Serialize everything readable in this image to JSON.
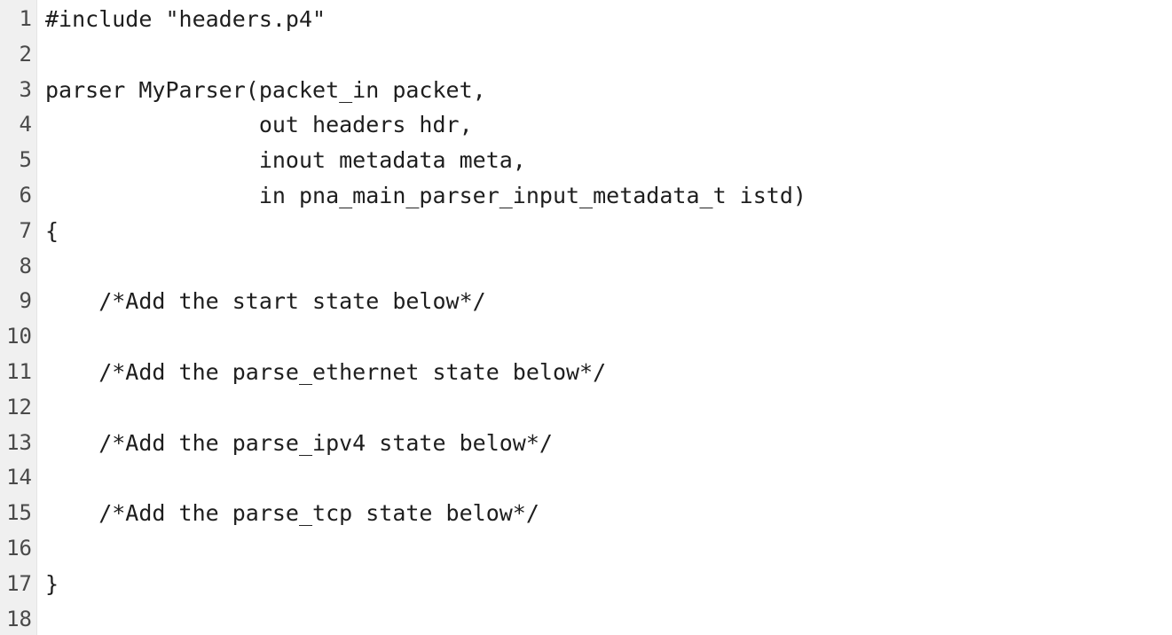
{
  "editor": {
    "lines": [
      {
        "number": "1",
        "text": "#include \"headers.p4\""
      },
      {
        "number": "2",
        "text": ""
      },
      {
        "number": "3",
        "text": "parser MyParser(packet_in packet,"
      },
      {
        "number": "4",
        "text": "                out headers hdr,"
      },
      {
        "number": "5",
        "text": "                inout metadata meta,"
      },
      {
        "number": "6",
        "text": "                in pna_main_parser_input_metadata_t istd)"
      },
      {
        "number": "7",
        "text": "{"
      },
      {
        "number": "8",
        "text": ""
      },
      {
        "number": "9",
        "text": "    /*Add the start state below*/"
      },
      {
        "number": "10",
        "text": ""
      },
      {
        "number": "11",
        "text": "    /*Add the parse_ethernet state below*/"
      },
      {
        "number": "12",
        "text": ""
      },
      {
        "number": "13",
        "text": "    /*Add the parse_ipv4 state below*/"
      },
      {
        "number": "14",
        "text": ""
      },
      {
        "number": "15",
        "text": "    /*Add the parse_tcp state below*/"
      },
      {
        "number": "16",
        "text": ""
      },
      {
        "number": "17",
        "text": "}"
      },
      {
        "number": "18",
        "text": ""
      }
    ]
  }
}
